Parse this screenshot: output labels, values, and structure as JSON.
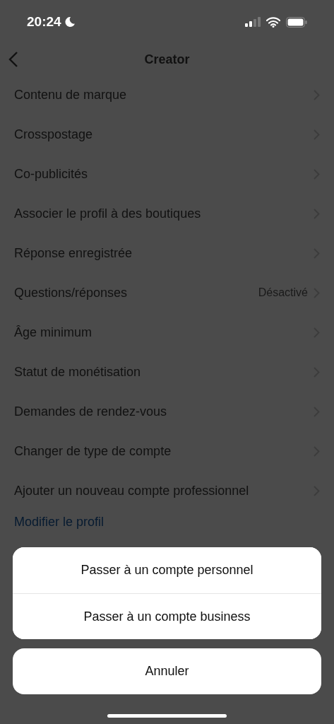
{
  "status_bar": {
    "time": "20:24"
  },
  "header": {
    "title": "Creator"
  },
  "settings": [
    {
      "label": "Contenu de marque"
    },
    {
      "label": "Crosspostage"
    },
    {
      "label": "Co-publicités"
    },
    {
      "label": "Associer le profil à des boutiques"
    },
    {
      "label": "Réponse enregistrée"
    },
    {
      "label": "Questions/réponses",
      "value": "Désactivé"
    },
    {
      "label": "Âge minimum"
    },
    {
      "label": "Statut de monétisation"
    },
    {
      "label": "Demandes de rendez-vous"
    },
    {
      "label": "Changer de type de compte"
    },
    {
      "label": "Ajouter un nouveau compte professionnel"
    }
  ],
  "edit_profile_link": "Modifier le profil",
  "action_sheet": {
    "options": [
      "Passer à un compte personnel",
      "Passer à un compte business"
    ],
    "cancel": "Annuler"
  }
}
